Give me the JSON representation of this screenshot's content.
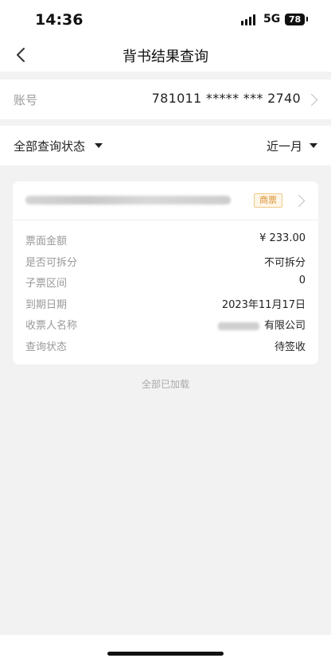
{
  "status_bar": {
    "time": "14:36",
    "network": "5G",
    "battery": "78"
  },
  "nav": {
    "title": "背书结果查询"
  },
  "account": {
    "label": "账号",
    "value": "781011 ***** *** 2740"
  },
  "filters": {
    "status": "全部查询状态",
    "period": "近一月"
  },
  "card": {
    "badge": "商票",
    "details": [
      {
        "label": "票面金额",
        "value": "¥ 233.00"
      },
      {
        "label": "是否可拆分",
        "value": "不可拆分"
      },
      {
        "label": "子票区间",
        "value": "0"
      },
      {
        "label": "到期日期",
        "value": "2023年11月17日"
      },
      {
        "label": "收票人名称",
        "value": "有限公司"
      },
      {
        "label": "查询状态",
        "value": "待签收"
      }
    ]
  },
  "footer_note": "全部已加载",
  "colors": {
    "badge_text": "#d98e2e",
    "badge_bg": "#fff6e8",
    "page_bg": "#f2f2f2"
  }
}
